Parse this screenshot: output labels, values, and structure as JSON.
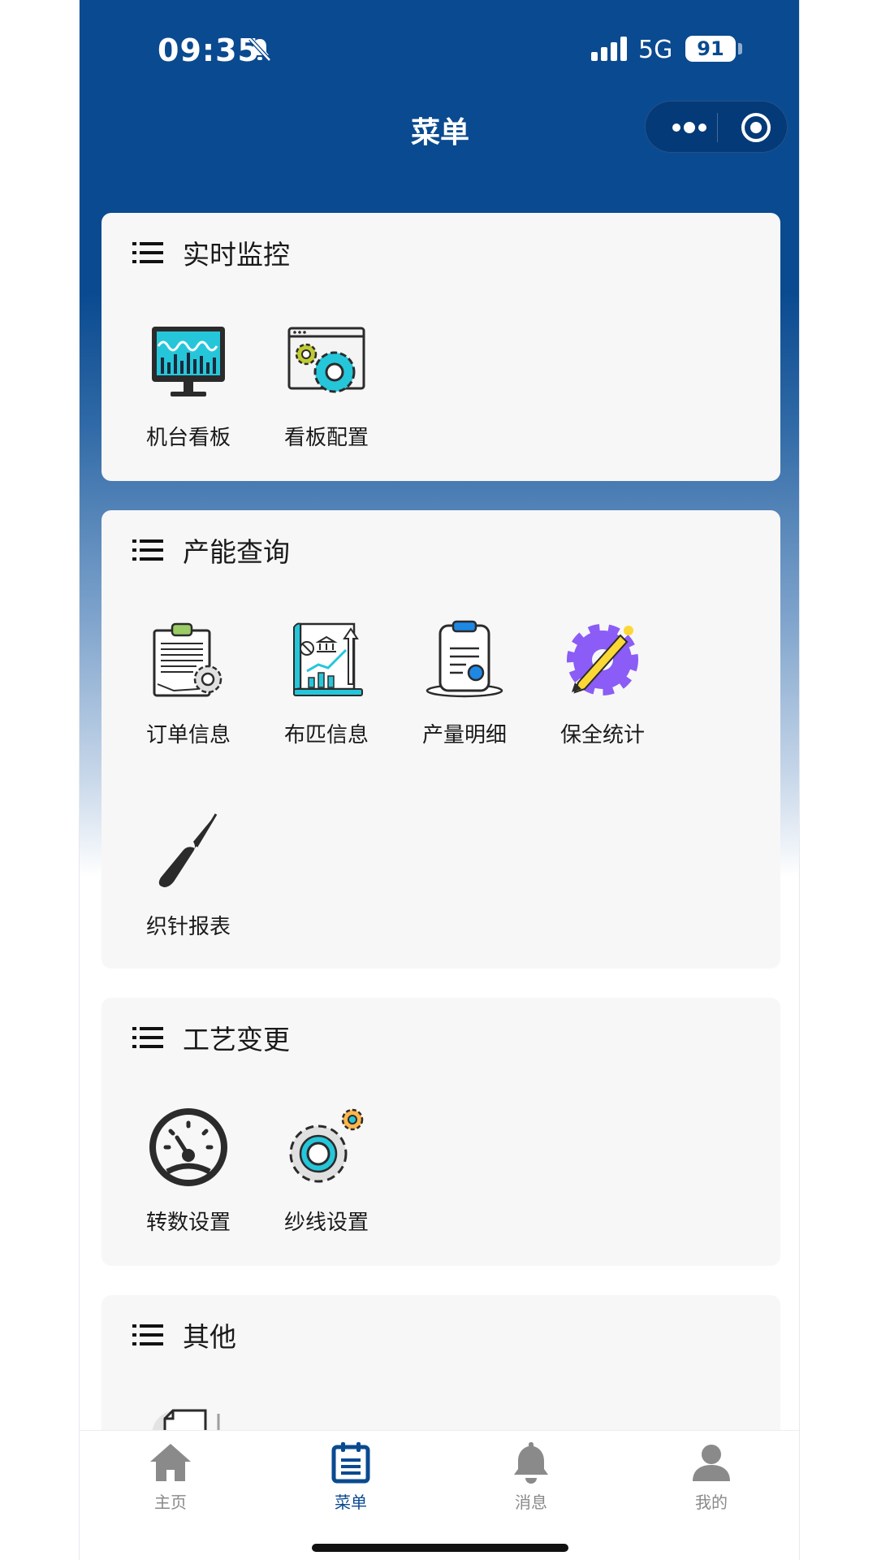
{
  "status": {
    "time": "09:35",
    "network": "5G",
    "battery": "91"
  },
  "nav": {
    "title": "菜单"
  },
  "sections": [
    {
      "title": "实时监控",
      "items": [
        {
          "label": "机台看板",
          "icon": "machine-dashboard-icon"
        },
        {
          "label": "看板配置",
          "icon": "dashboard-config-icon"
        }
      ]
    },
    {
      "title": "产能查询",
      "items": [
        {
          "label": "订单信息",
          "icon": "order-clipboard-icon"
        },
        {
          "label": "布匹信息",
          "icon": "fabric-report-icon"
        },
        {
          "label": "产量明细",
          "icon": "output-clipboard-icon"
        },
        {
          "label": "保全统计",
          "icon": "maintenance-gear-icon"
        },
        {
          "label": "织针报表",
          "icon": "knitting-needle-icon"
        }
      ]
    },
    {
      "title": "工艺变更",
      "items": [
        {
          "label": "转数设置",
          "icon": "speedometer-icon"
        },
        {
          "label": "纱线设置",
          "icon": "yarn-gear-icon"
        }
      ]
    },
    {
      "title": "其他",
      "items": []
    }
  ],
  "tabbar": {
    "active": 1,
    "tabs": [
      {
        "label": "主页",
        "icon": "home-icon"
      },
      {
        "label": "菜单",
        "icon": "menu-calendar-icon"
      },
      {
        "label": "消息",
        "icon": "bell-icon"
      },
      {
        "label": "我的",
        "icon": "user-icon"
      }
    ]
  },
  "colors": {
    "brand": "#0a4a90",
    "card": "#f7f7f7",
    "tab_inactive": "#8a8a8a",
    "accent_cyan": "#26c6da",
    "accent_purple": "#8b5cf6"
  }
}
